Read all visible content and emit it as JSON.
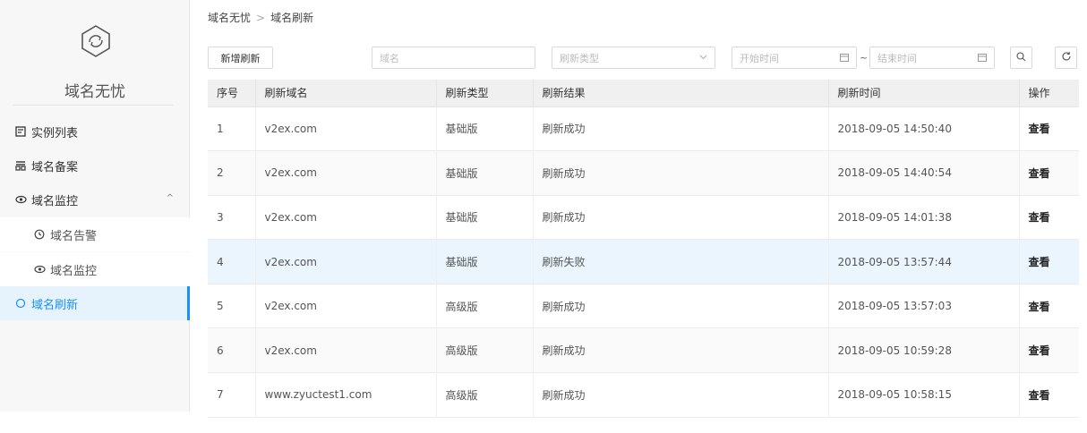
{
  "sidebar": {
    "brand": "域名无忧",
    "items": [
      {
        "label": "实例列表"
      },
      {
        "label": "域名备案"
      },
      {
        "label": "域名监控"
      },
      {
        "label": "域名告警"
      },
      {
        "label": "域名监控"
      },
      {
        "label": "域名刷新"
      }
    ]
  },
  "breadcrumb": {
    "root": "域名无忧",
    "separator": ">",
    "current": "域名刷新"
  },
  "toolbar": {
    "add_label": "新增刷新",
    "domain_placeholder": "域名",
    "type_placeholder": "刷新类型",
    "start_placeholder": "开始时间",
    "range_sep": "~",
    "end_placeholder": "结束时间"
  },
  "table": {
    "headers": [
      "序号",
      "刷新域名",
      "刷新类型",
      "刷新结果",
      "刷新时间",
      "操作"
    ],
    "rows": [
      {
        "no": "1",
        "domain": "v2ex.com",
        "type": "基础版",
        "result": "刷新成功",
        "time": "2018-09-05 14:50:40",
        "action": "查看"
      },
      {
        "no": "2",
        "domain": "v2ex.com",
        "type": "基础版",
        "result": "刷新成功",
        "time": "2018-09-05 14:40:54",
        "action": "查看"
      },
      {
        "no": "3",
        "domain": "v2ex.com",
        "type": "基础版",
        "result": "刷新成功",
        "time": "2018-09-05 14:01:38",
        "action": "查看"
      },
      {
        "no": "4",
        "domain": "v2ex.com",
        "type": "基础版",
        "result": "刷新失败",
        "time": "2018-09-05 13:57:44",
        "action": "查看"
      },
      {
        "no": "5",
        "domain": "v2ex.com",
        "type": "高级版",
        "result": "刷新成功",
        "time": "2018-09-05 13:57:03",
        "action": "查看"
      },
      {
        "no": "6",
        "domain": "v2ex.com",
        "type": "高级版",
        "result": "刷新成功",
        "time": "2018-09-05 10:59:28",
        "action": "查看"
      },
      {
        "no": "7",
        "domain": "www.zyuctest1.com",
        "type": "高级版",
        "result": "刷新成功",
        "time": "2018-09-05 10:58:15",
        "action": "查看"
      }
    ]
  },
  "colors": {
    "accent": "#1890ff",
    "highlight_row": "#eaf5fd"
  },
  "icons": [
    "logo-icon",
    "list-icon",
    "record-icon",
    "eye-icon",
    "clock-icon",
    "eye-icon",
    "refresh-icon",
    "chevron-up-icon",
    "chevron-down-icon",
    "calendar-icon",
    "search-icon",
    "reload-icon"
  ]
}
